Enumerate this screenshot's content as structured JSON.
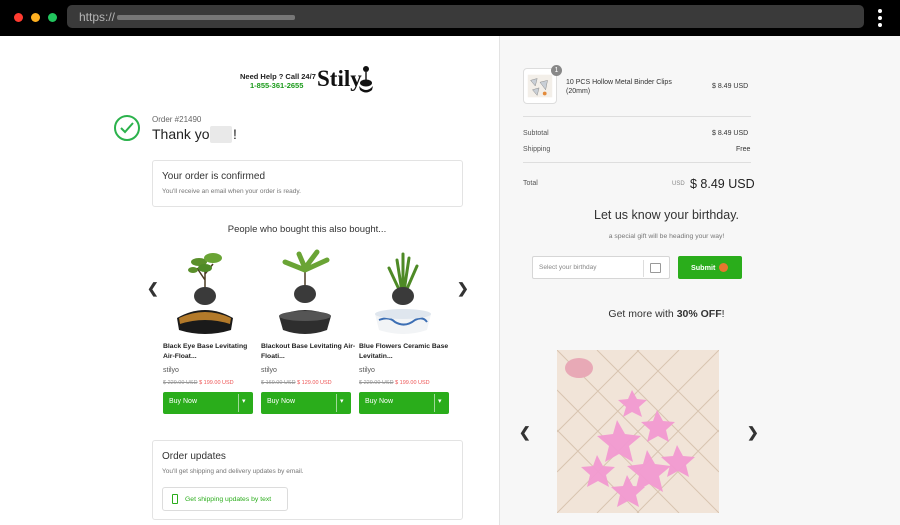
{
  "browser": {
    "url_scheme": "https://"
  },
  "store": {
    "help_line": "Need Help ? Call 24/7",
    "phone": "1-855-361-2655",
    "brand": "Stily"
  },
  "confirmation": {
    "order_number": "Order #21490",
    "thanks": "Thank you",
    "exclaim": "!",
    "confirmed_title": "Your order is confirmed",
    "confirmed_sub": "You'll receive an email when your order is ready."
  },
  "recommendations": {
    "heading": "People who bought this also bought...",
    "products": [
      {
        "name": "Black Eye Base Levitating Air-Float...",
        "seller": "stilyo",
        "old_price": "$ 229.00 USD",
        "new_price": "$ 199.00 USD",
        "buy_label": "Buy Now"
      },
      {
        "name": "Blackout Base Levitating Air-Floati...",
        "seller": "stilyo",
        "old_price": "$ 169.00 USD",
        "new_price": "$ 129.00 USD",
        "buy_label": "Buy Now"
      },
      {
        "name": "Blue Flowers Ceramic Base Levitatin...",
        "seller": "stilyo",
        "old_price": "$ 229.00 USD",
        "new_price": "$ 199.00 USD",
        "buy_label": "Buy Now"
      }
    ]
  },
  "updates": {
    "title": "Order updates",
    "sub": "You'll get shipping and delivery updates by email.",
    "sms_label": "Get shipping updates by text"
  },
  "summary": {
    "item_qty": "1",
    "item_name": "10 PCS Hollow Metal Binder Clips (20mm)",
    "item_price": "$ 8.49 USD",
    "subtotal_label": "Subtotal",
    "subtotal_value": "$ 8.49 USD",
    "shipping_label": "Shipping",
    "shipping_value": "Free",
    "total_label": "Total",
    "total_currency": "USD",
    "total_value": "$ 8.49 USD"
  },
  "birthday": {
    "heading": "Let us know your birthday.",
    "sub": "a special gift will be heading your way!",
    "placeholder": "Select your birthday",
    "submit_label": "Submit"
  },
  "promo": {
    "text_before": "Get more with ",
    "text_bold": "30% OFF",
    "text_after": "!"
  },
  "colors": {
    "accent_green": "#2aad1b",
    "check_green": "#2bb24c",
    "sale_red": "#e55555"
  }
}
